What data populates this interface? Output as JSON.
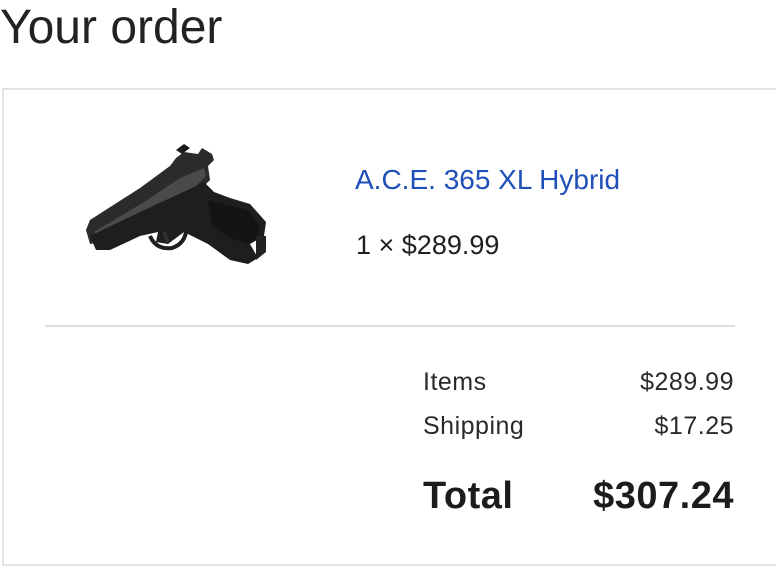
{
  "page": {
    "title": "Your order"
  },
  "order": {
    "item": {
      "name": "A.C.E. 365 XL Hybrid",
      "quantity_price": "1 × $289.99",
      "image_icon": "pistol-product-image"
    },
    "summary": {
      "items_label": "Items",
      "items_value": "$289.99",
      "shipping_label": "Shipping",
      "shipping_value": "$17.25",
      "total_label": "Total",
      "total_value": "$307.24"
    }
  },
  "colors": {
    "link": "#1f4fb8",
    "border": "#e2e2e2",
    "text": "#1f1f1f"
  }
}
